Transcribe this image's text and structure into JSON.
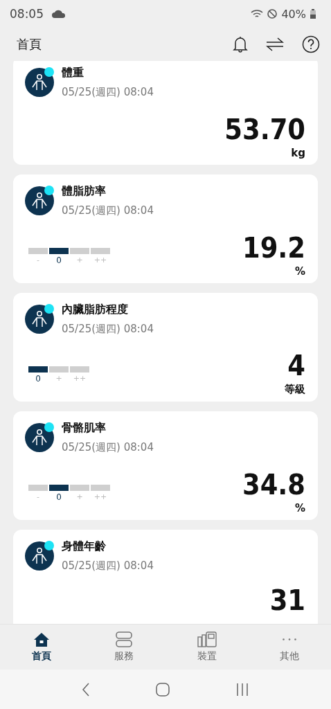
{
  "status_bar": {
    "time": "08:05",
    "battery": "40%"
  },
  "header": {
    "title": "首頁"
  },
  "cards": [
    {
      "title": "體重",
      "date": "05/25(週四) 08:04",
      "value": "53.70",
      "unit": "kg"
    },
    {
      "title": "體脂肪率",
      "date": "05/25(週四) 08:04",
      "value": "19.2",
      "unit": "%",
      "scale": [
        {
          "label": "-",
          "selected": false
        },
        {
          "label": "0",
          "selected": true
        },
        {
          "label": "+",
          "selected": false
        },
        {
          "label": "++",
          "selected": false
        }
      ]
    },
    {
      "title": "內臟脂肪程度",
      "date": "05/25(週四) 08:04",
      "value": "4",
      "unit": "等級",
      "scale": [
        {
          "label": "0",
          "selected": true
        },
        {
          "label": "+",
          "selected": false
        },
        {
          "label": "++",
          "selected": false
        }
      ]
    },
    {
      "title": "骨骼肌率",
      "date": "05/25(週四) 08:04",
      "value": "34.8",
      "unit": "%",
      "scale": [
        {
          "label": "-",
          "selected": false
        },
        {
          "label": "0",
          "selected": true
        },
        {
          "label": "+",
          "selected": false
        },
        {
          "label": "++",
          "selected": false
        }
      ]
    },
    {
      "title": "身體年齡",
      "date": "05/25(週四) 08:04",
      "value": "31"
    }
  ],
  "bottom_nav": [
    {
      "label": "首頁",
      "kind": "home",
      "selected": true
    },
    {
      "label": "服務",
      "kind": "services",
      "selected": false
    },
    {
      "label": "裝置",
      "kind": "devices",
      "selected": false
    },
    {
      "label": "其他",
      "kind": "more",
      "selected": false
    }
  ]
}
